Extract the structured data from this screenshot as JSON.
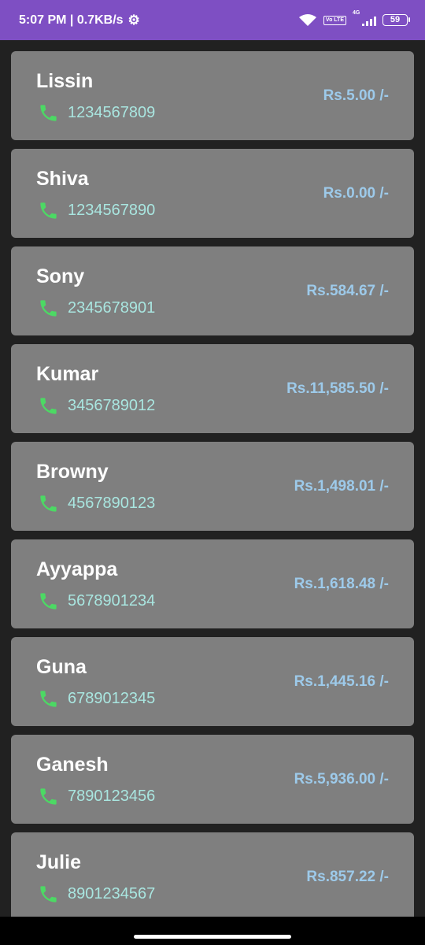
{
  "status_bar": {
    "time_speed": "5:07 PM | 0.7KB/s",
    "volte_label": "Vo LTE",
    "network_type": "4G",
    "battery_level": "59",
    "icons": [
      "gear-icon",
      "wifi-icon",
      "volte-icon",
      "signal-icon",
      "battery-icon"
    ]
  },
  "colors": {
    "status_bar": "#7e4fc3",
    "background": "#212121",
    "card": "#7f7f7f",
    "name_text": "#ffffff",
    "phone_text": "#a9e6e0",
    "amount_text": "#9dcaea",
    "phone_icon": "#4cd964"
  },
  "contacts": [
    {
      "name": "Lissin",
      "phone": "1234567809",
      "amount": "Rs.5.00 /-"
    },
    {
      "name": "Shiva",
      "phone": "1234567890",
      "amount": "Rs.0.00 /-"
    },
    {
      "name": "Sony",
      "phone": "2345678901",
      "amount": "Rs.584.67 /-"
    },
    {
      "name": "Kumar",
      "phone": "3456789012",
      "amount": "Rs.11,585.50 /-"
    },
    {
      "name": "Browny",
      "phone": "4567890123",
      "amount": "Rs.1,498.01 /-"
    },
    {
      "name": "Ayyappa",
      "phone": "5678901234",
      "amount": "Rs.1,618.48 /-"
    },
    {
      "name": "Guna",
      "phone": "6789012345",
      "amount": "Rs.1,445.16 /-"
    },
    {
      "name": "Ganesh",
      "phone": "7890123456",
      "amount": "Rs.5,936.00 /-"
    },
    {
      "name": "Julie",
      "phone": "8901234567",
      "amount": "Rs.857.22 /-"
    }
  ]
}
